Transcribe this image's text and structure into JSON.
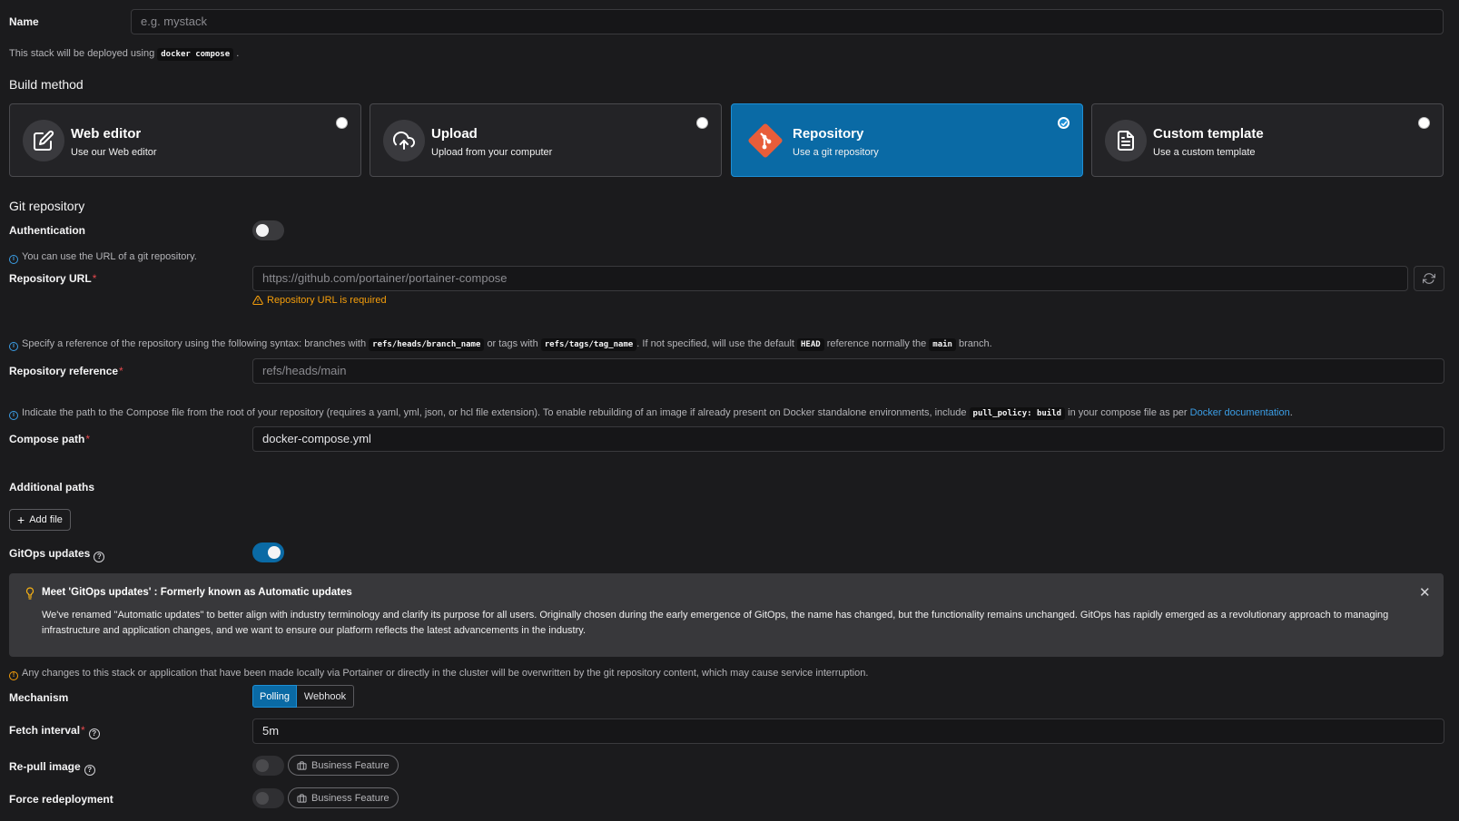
{
  "name": {
    "label": "Name",
    "placeholder": "e.g. mystack",
    "hint_prefix": "This stack will be deployed using",
    "hint_code": "docker compose",
    "hint_suffix": "."
  },
  "build_method": {
    "title": "Build method",
    "options": [
      {
        "title": "Web editor",
        "subtitle": "Use our Web editor",
        "icon": "edit-icon",
        "selected": false
      },
      {
        "title": "Upload",
        "subtitle": "Upload from your computer",
        "icon": "cloud-upload-icon",
        "selected": false
      },
      {
        "title": "Repository",
        "subtitle": "Use a git repository",
        "icon": "git-icon",
        "selected": true
      },
      {
        "title": "Custom template",
        "subtitle": "Use a custom template",
        "icon": "file-text-icon",
        "selected": false
      }
    ]
  },
  "git": {
    "title": "Git repository",
    "auth_label": "Authentication",
    "auth_enabled": false,
    "url_hint": "You can use the URL of a git repository.",
    "url_label": "Repository URL",
    "url_placeholder": "https://github.com/portainer/portainer-compose",
    "url_error": "Repository URL is required",
    "ref_hint_1": "Specify a reference of the repository using the following syntax: branches with",
    "ref_code_1": "refs/heads/branch_name",
    "ref_hint_2": "or tags with",
    "ref_code_2": "refs/tags/tag_name",
    "ref_hint_3": ". If not specified, will use the default",
    "ref_code_3": "HEAD",
    "ref_hint_4": "reference normally the",
    "ref_code_4": "main",
    "ref_hint_5": "branch.",
    "ref_label": "Repository reference",
    "ref_placeholder": "refs/heads/main",
    "compose_hint_1": "Indicate the path to the Compose file from the root of your repository (requires a yaml, yml, json, or hcl file extension).  To enable rebuilding of an image if already present on Docker standalone environments, include",
    "compose_code": "pull_policy: build",
    "compose_hint_2": "in your compose file as per",
    "compose_link": "Docker documentation",
    "compose_hint_3": ".",
    "compose_label": "Compose path",
    "compose_value": "docker-compose.yml",
    "additional_paths": "Additional paths",
    "add_file": "Add file"
  },
  "gitops": {
    "label": "GitOps updates",
    "enabled": true,
    "banner_title": "Meet 'GitOps updates' : Formerly known as Automatic updates",
    "banner_body": "We've renamed \"Automatic updates\" to better align with industry terminology and clarify its purpose for all users. Originally chosen during the early emergence of GitOps, the name has changed, but the functionality remains unchanged. GitOps has rapidly emerged as a revolutionary approach to managing infrastructure and application changes, and we want to ensure our platform reflects the latest advancements in the industry.",
    "warning": "Any changes to this stack or application that have been made locally via Portainer or directly in the cluster will be overwritten by the git repository content, which may cause service interruption.",
    "mechanism_label": "Mechanism",
    "mechanism_options": [
      "Polling",
      "Webhook"
    ],
    "mechanism_selected": "Polling",
    "fetch_label": "Fetch interval",
    "fetch_value": "5m",
    "repull_label": "Re-pull image",
    "force_label": "Force redeployment",
    "business_feature": "Business Feature"
  },
  "colors": {
    "accent": "#0a6aa5",
    "error": "#e5484d",
    "warning": "#f59e0b",
    "link": "#3b9ee6",
    "git_orange": "#e85d3a"
  }
}
